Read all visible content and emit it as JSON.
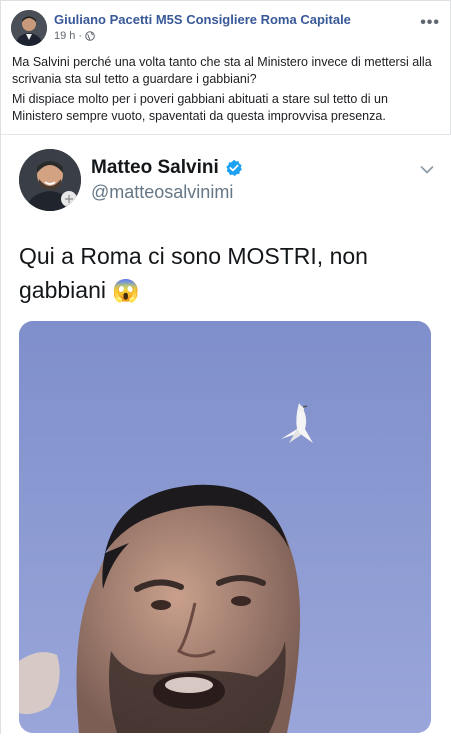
{
  "post": {
    "author": "Giuliano Pacetti M5S Consigliere Roma Capitale",
    "time": "19 h",
    "privacy_icon": "globe-icon",
    "more_icon": "more-options-icon",
    "more_label": "•••",
    "paragraphs": [
      "Ma Salvini perché una volta tanto che sta al Ministero invece di mettersi alla scrivania sta sul tetto a guardare i gabbiani?",
      "Mi dispiace molto per i poveri gabbiani abituati a stare sul tetto di un Ministero sempre vuoto, spaventati da questa improvvisa presenza."
    ]
  },
  "tweet": {
    "name": "Matteo Salvini",
    "handle": "@matteosalvinimi",
    "verified_icon": "verified-badge-icon",
    "chevron_icon": "chevron-down-icon",
    "text": "Qui a Roma ci sono MOSTRI, non gabbiani",
    "emoji": "😱",
    "media_description_icon": "selfie-photo"
  },
  "colors": {
    "author_link": "#385898",
    "verified": "#1da1f2",
    "sky": "#8a9ad2"
  }
}
